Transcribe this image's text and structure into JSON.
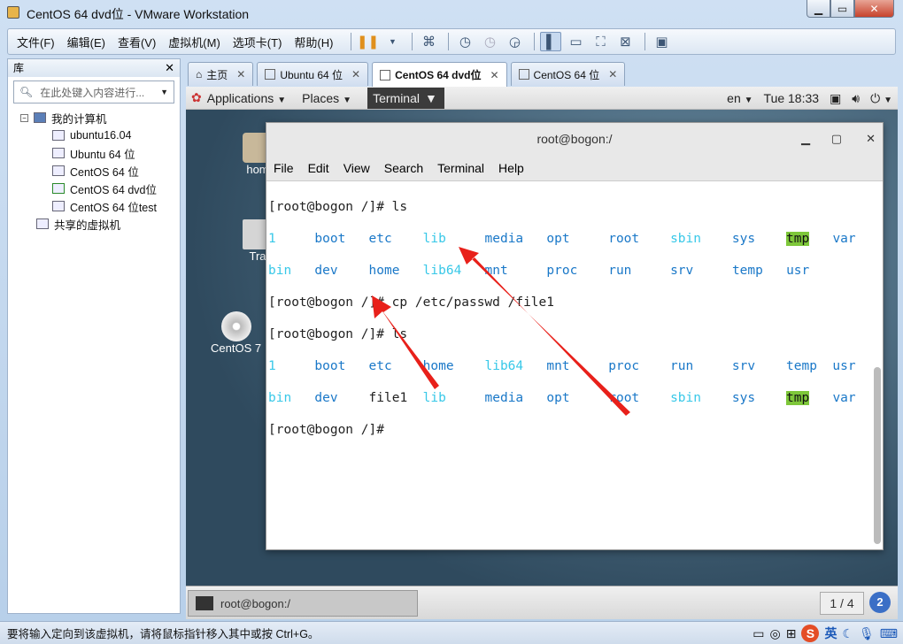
{
  "window": {
    "title": "CentOS 64 dvd位 - VMware Workstation"
  },
  "menu": [
    "文件(F)",
    "编辑(E)",
    "查看(V)",
    "虚拟机(M)",
    "选项卡(T)",
    "帮助(H)"
  ],
  "library": {
    "title": "库",
    "search_placeholder": "在此处键入内容进行...",
    "root": "我的计算机",
    "vms": [
      "ubuntu16.04",
      "Ubuntu 64 位",
      "CentOS 64 位",
      "CentOS 64 dvd位",
      "CentOS 64 位test"
    ],
    "shared": "共享的虚拟机"
  },
  "tabs": [
    "主页",
    "Ubuntu 64 位",
    "CentOS 64 dvd位",
    "CentOS 64 位"
  ],
  "gnome": {
    "applications": "Applications",
    "places": "Places",
    "terminal": "Terminal",
    "lang": "en",
    "clock": "Tue 18:33"
  },
  "desktop": {
    "home": "hom",
    "trash": "Tra",
    "dvd": "CentOS 7"
  },
  "terminal": {
    "title": "root@bogon:/",
    "menu": [
      "File",
      "Edit",
      "View",
      "Search",
      "Terminal",
      "Help"
    ],
    "prompt1": "[root@bogon /]# ls",
    "cmd_cp": "[root@bogon /]# cp /etc/passwd /file1",
    "prompt3": "[root@bogon /]# ls",
    "prompt4": "[root@bogon /]# ",
    "ls1_row1": [
      "1",
      "boot",
      "etc",
      "lib",
      "media",
      "opt",
      "root",
      "sbin",
      "sys",
      "tmp",
      "var"
    ],
    "ls1_row2": [
      "bin",
      "dev",
      "home",
      "lib64",
      "mnt",
      "proc",
      "run",
      "srv",
      "temp",
      "usr"
    ],
    "ls2_row1": [
      "1",
      "boot",
      "etc",
      "home",
      "lib64",
      "mnt",
      "proc",
      "run",
      "srv",
      "temp",
      "usr"
    ],
    "ls2_row2": [
      "bin",
      "dev",
      "file1",
      "lib",
      "media",
      "opt",
      "root",
      "sbin",
      "sys",
      "tmp",
      "var"
    ]
  },
  "taskbar": {
    "item": "root@bogon:/",
    "pager": "1 / 4",
    "help": "2"
  },
  "status": {
    "text": "要将输入定向到该虚拟机，请将鼠标指针移入其中或按 Ctrl+G。",
    "ime_label": "S",
    "ime_mode": "英"
  },
  "colors": {
    "dir": "#18a8d8",
    "highlight": "#7ec73a",
    "arrow": "#e8201a"
  }
}
